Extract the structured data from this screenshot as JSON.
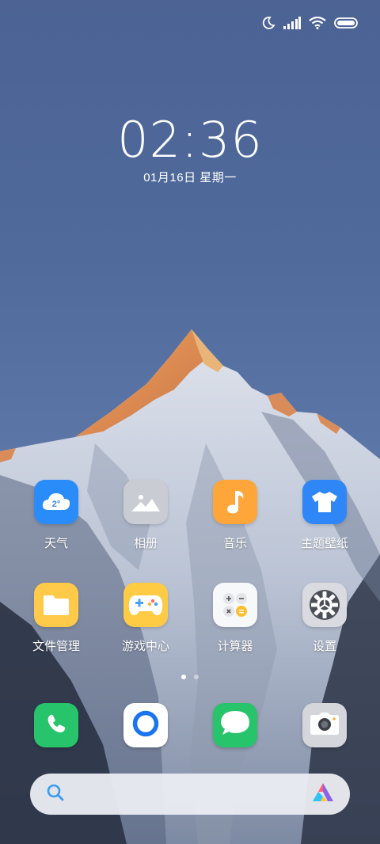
{
  "status_bar": {
    "icons": [
      "moon-icon",
      "signal-icon",
      "wifi-icon",
      "battery-icon"
    ]
  },
  "lock": {
    "time": "02:36",
    "date": "01月16日 星期一"
  },
  "apps": [
    {
      "id": "weather",
      "label": "天气",
      "icon": "weather-cloud-icon",
      "badge_text": "2°",
      "color": "#2a8cf8"
    },
    {
      "id": "gallery",
      "label": "相册",
      "icon": "gallery-icon",
      "color": "#c9ccd3"
    },
    {
      "id": "music",
      "label": "音乐",
      "icon": "music-note-icon",
      "color": "#ffa63a"
    },
    {
      "id": "themes",
      "label": "主题壁纸",
      "icon": "tshirt-icon",
      "color": "#2f86f6"
    },
    {
      "id": "files",
      "label": "文件管理",
      "icon": "folder-icon",
      "color": "#ffc94a"
    },
    {
      "id": "games",
      "label": "游戏中心",
      "icon": "gamepad-icon",
      "color": "#ffcb45"
    },
    {
      "id": "calculator",
      "label": "计算器",
      "icon": "calculator-icon",
      "color": "#f7f8fa"
    },
    {
      "id": "settings",
      "label": "设置",
      "icon": "gear-icon",
      "color": "#d9dbe0"
    }
  ],
  "page_indicator": {
    "pages": 2,
    "current": 1
  },
  "dock": [
    {
      "id": "phone",
      "icon": "phone-icon",
      "color": "#27c46b"
    },
    {
      "id": "browser",
      "icon": "browser-icon",
      "color": "#ffffff"
    },
    {
      "id": "messages",
      "icon": "message-icon",
      "color": "#27c46b"
    },
    {
      "id": "camera",
      "icon": "camera-icon",
      "color": "#d4d6db"
    }
  ],
  "search": {
    "left_icon": "search-icon",
    "right_icon": "assistant-logo-icon"
  },
  "colors": {
    "accent_blue": "#2a8cf8",
    "search_icon": "#3a9bf0"
  }
}
